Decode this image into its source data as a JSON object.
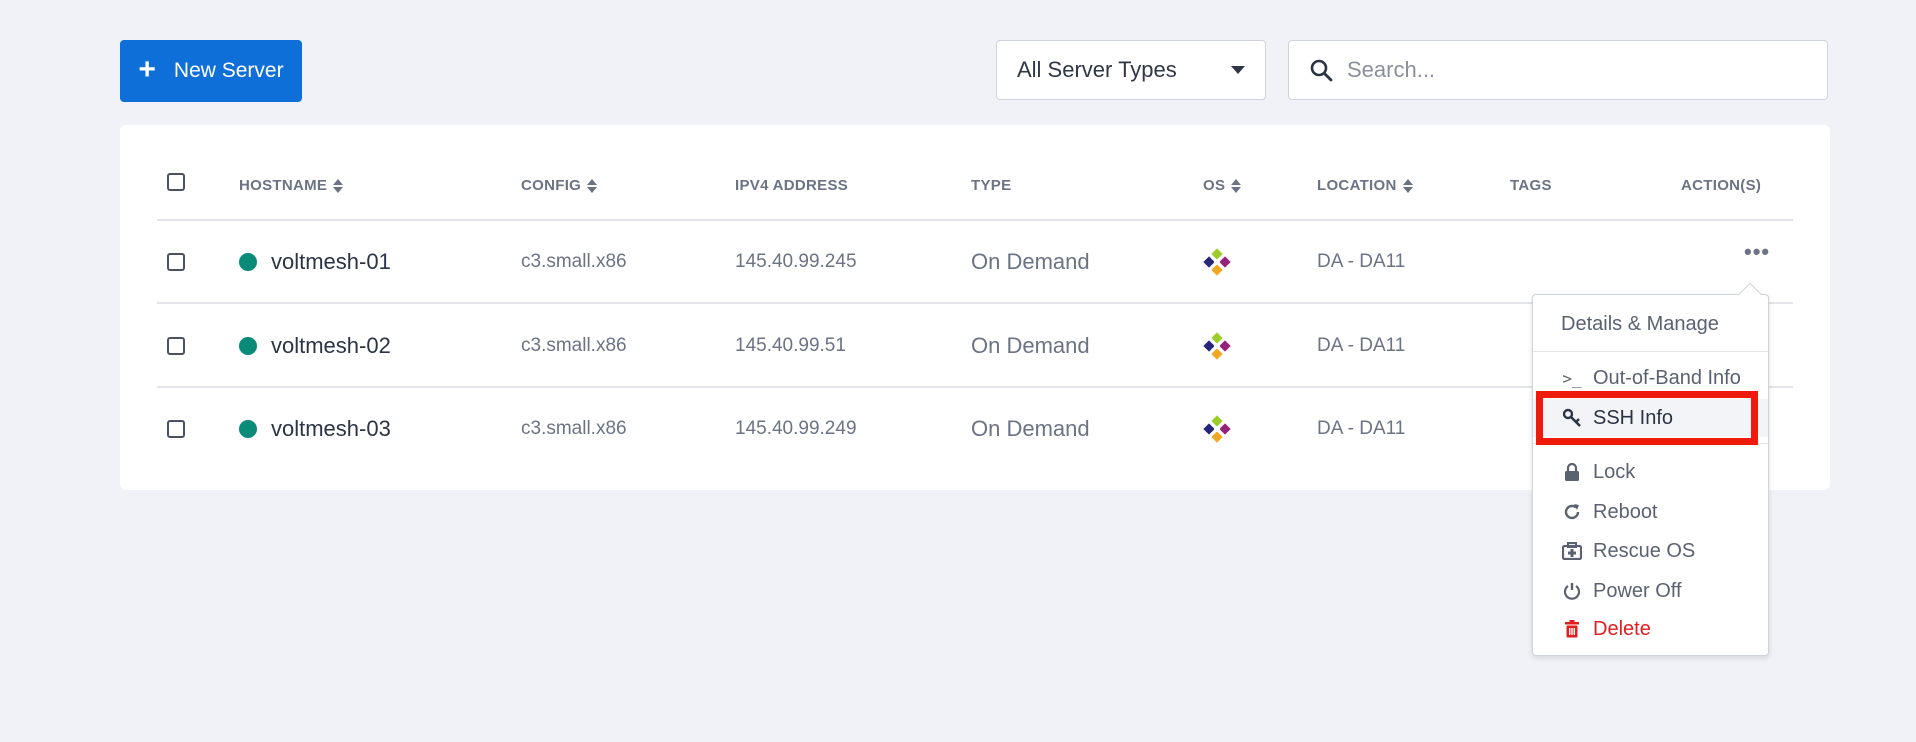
{
  "toolbar": {
    "new_server_label": "New Server",
    "type_filter_value": "All Server Types",
    "search_placeholder": "Search..."
  },
  "table": {
    "headers": {
      "hostname": "HOSTNAME",
      "config": "CONFIG",
      "ipv4": "IPV4 ADDRESS",
      "type": "TYPE",
      "os": "OS",
      "location": "LOCATION",
      "tags": "TAGS",
      "actions": "ACTION(S)"
    },
    "rows": [
      {
        "hostname": "voltmesh-01",
        "config": "c3.small.x86",
        "ipv4": "145.40.99.245",
        "type": "On Demand",
        "location": "DA - DA11"
      },
      {
        "hostname": "voltmesh-02",
        "config": "c3.small.x86",
        "ipv4": "145.40.99.51",
        "type": "On Demand",
        "location": "DA - DA11"
      },
      {
        "hostname": "voltmesh-03",
        "config": "c3.small.x86",
        "ipv4": "145.40.99.249",
        "type": "On Demand",
        "location": "DA - DA11"
      }
    ],
    "actions_glyph": "•••"
  },
  "menu": {
    "details": "Details & Manage",
    "oob": "Out-of-Band Info",
    "ssh": "SSH Info",
    "lock": "Lock",
    "reboot": "Reboot",
    "rescue": "Rescue OS",
    "power_off": "Power Off",
    "delete": "Delete"
  },
  "colors": {
    "primary": "#0e6fd9",
    "status_active": "#0a8a78",
    "danger": "#e01e1e",
    "highlight": "#ee1b0c"
  }
}
